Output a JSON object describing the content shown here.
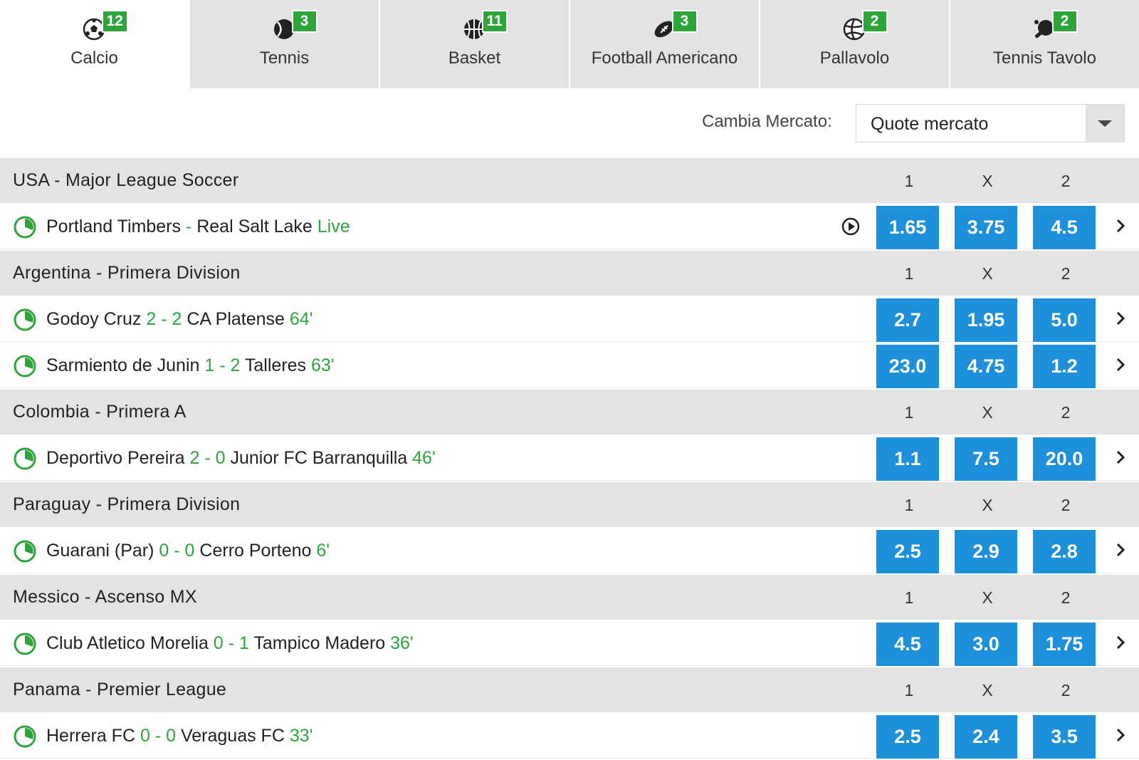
{
  "sports_tabs": [
    {
      "label": "Calcio",
      "count": "12",
      "icon": "soccer-ball-icon",
      "active": true
    },
    {
      "label": "Tennis",
      "count": "3",
      "icon": "tennis-ball-icon",
      "active": false
    },
    {
      "label": "Basket",
      "count": "11",
      "icon": "basketball-icon",
      "active": false
    },
    {
      "label": "Football Americano",
      "count": "3",
      "icon": "american-football-icon",
      "active": false
    },
    {
      "label": "Pallavolo",
      "count": "2",
      "icon": "volleyball-icon",
      "active": false
    },
    {
      "label": "Tennis Tavolo",
      "count": "2",
      "icon": "table-tennis-icon",
      "active": false
    }
  ],
  "market": {
    "label": "Cambia Mercato:",
    "selected": "Quote mercato"
  },
  "odds_headers": {
    "home": "1",
    "draw": "X",
    "away": "2"
  },
  "leagues": [
    {
      "name": "USA - Major League Soccer",
      "matches": [
        {
          "home": "Portland Timbers",
          "sep": "-",
          "away": "Real Salt Lake",
          "status": "Live",
          "stream": true,
          "odds": {
            "home": "1.65",
            "draw": "3.75",
            "away": "4.5"
          }
        }
      ]
    },
    {
      "name": "Argentina - Primera Division",
      "matches": [
        {
          "home": "Godoy Cruz",
          "home_score": "2",
          "sep": "-",
          "away_score": "2",
          "away": "CA Platense",
          "minute": "64'",
          "odds": {
            "home": "2.7",
            "draw": "1.95",
            "away": "5.0"
          }
        },
        {
          "home": "Sarmiento de Junin",
          "home_score": "1",
          "sep": "-",
          "away_score": "2",
          "away": "Talleres",
          "minute": "63'",
          "odds": {
            "home": "23.0",
            "draw": "4.75",
            "away": "1.2"
          }
        }
      ]
    },
    {
      "name": "Colombia - Primera A",
      "matches": [
        {
          "home": "Deportivo Pereira",
          "home_score": "2",
          "sep": "-",
          "away_score": "0",
          "away": "Junior FC Barranquilla",
          "minute": "46'",
          "odds": {
            "home": "1.1",
            "draw": "7.5",
            "away": "20.0"
          }
        }
      ]
    },
    {
      "name": "Paraguay - Primera Division",
      "matches": [
        {
          "home": "Guarani (Par)",
          "home_score": "0",
          "sep": "-",
          "away_score": "0",
          "away": "Cerro Porteno",
          "minute": "6'",
          "odds": {
            "home": "2.5",
            "draw": "2.9",
            "away": "2.8"
          }
        }
      ]
    },
    {
      "name": "Messico - Ascenso MX",
      "matches": [
        {
          "home": "Club Atletico Morelia",
          "home_score": "0",
          "sep": "-",
          "away_score": "1",
          "away": "Tampico Madero",
          "minute": "36'",
          "odds": {
            "home": "4.5",
            "draw": "3.0",
            "away": "1.75"
          }
        }
      ]
    },
    {
      "name": "Panama - Premier League",
      "matches": [
        {
          "home": "Herrera FC",
          "home_score": "0",
          "sep": "-",
          "away_score": "0",
          "away": "Veraguas FC",
          "minute": "33'",
          "odds": {
            "home": "2.5",
            "draw": "2.4",
            "away": "3.5"
          }
        }
      ]
    }
  ],
  "colors": {
    "odds_button": "#1e8fdb",
    "live_green": "#2ea53a",
    "header_gray": "#e3e3e3"
  }
}
